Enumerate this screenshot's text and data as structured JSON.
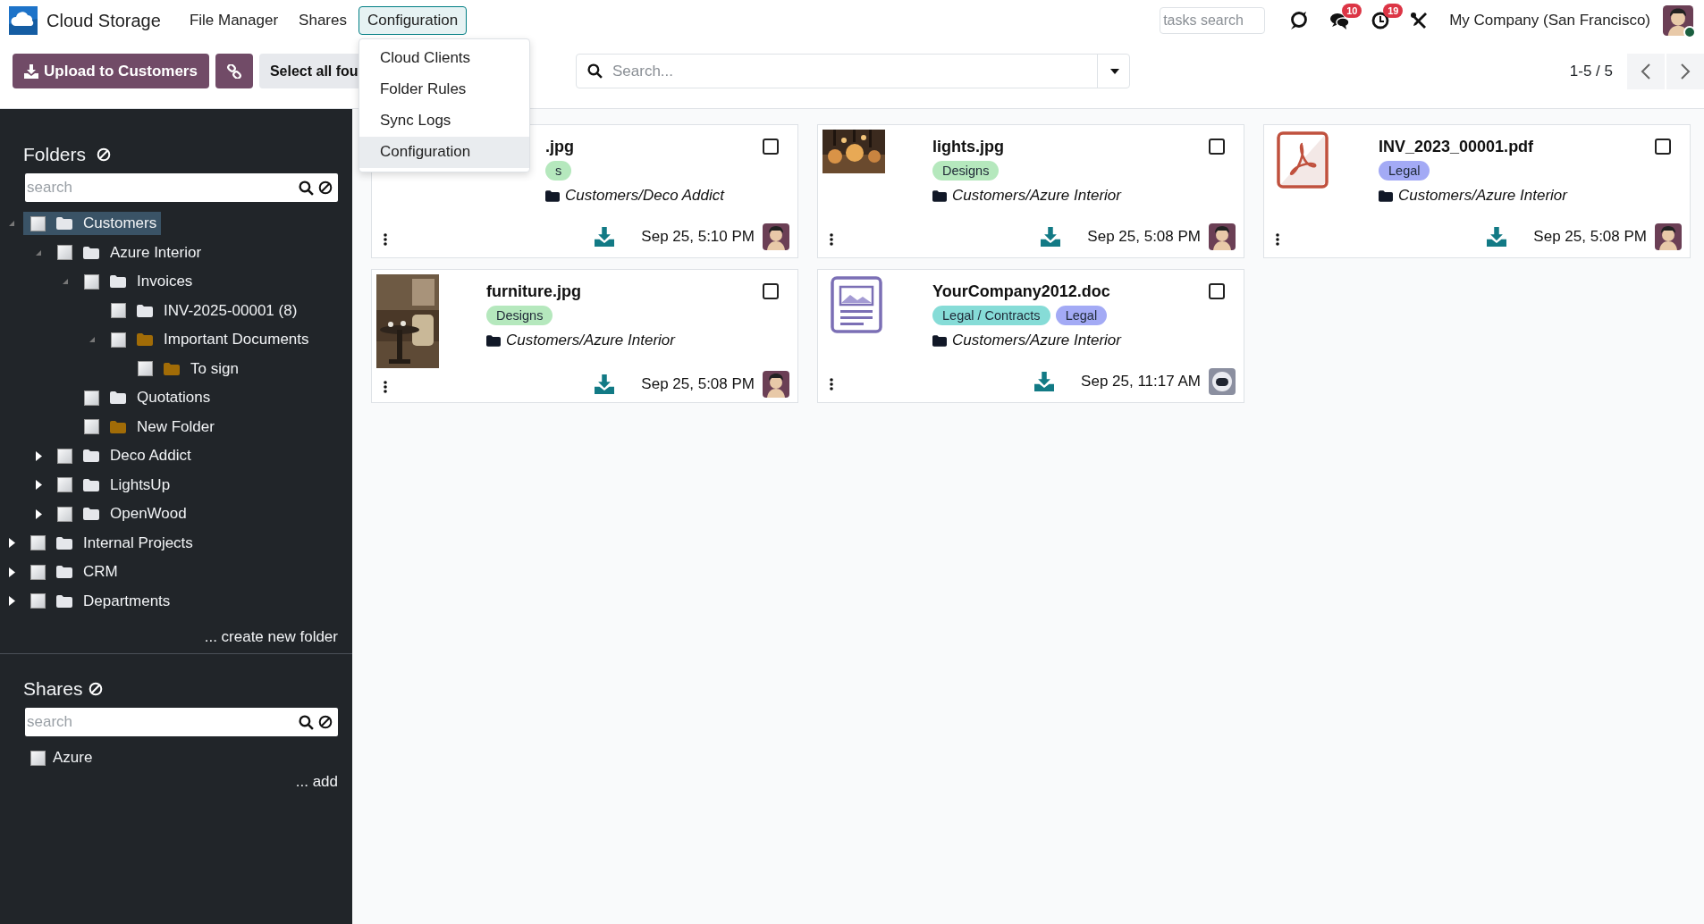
{
  "app": {
    "name": "Cloud Storage"
  },
  "menu": [
    {
      "label": "File Manager",
      "selected": false
    },
    {
      "label": "Shares",
      "selected": false
    },
    {
      "label": "Configuration",
      "selected": true
    }
  ],
  "dropdown": [
    {
      "label": "Cloud Clients",
      "selected": false
    },
    {
      "label": "Folder Rules",
      "selected": false
    },
    {
      "label": "Sync Logs",
      "selected": false
    },
    {
      "label": "Configuration",
      "selected": true
    }
  ],
  "systray": {
    "search_placeholder": "tasks search",
    "messages_badge": "10",
    "activities_badge": "19",
    "company": "My Company (San Francisco)",
    "online": true
  },
  "toolbar": {
    "upload_button": "Upload to Customers",
    "select_all_button": "Select all fou"
  },
  "search": {
    "placeholder": "Search..."
  },
  "pager": {
    "range": "1-5 / 5"
  },
  "folders": {
    "title": "Folders",
    "search_placeholder": "search",
    "create_link": "... create new folder",
    "tree": [
      {
        "label": "Customers",
        "checked": false,
        "selected": true,
        "expanded": true,
        "color": "#e5e7eb",
        "children": [
          {
            "label": "Azure Interior",
            "checked": false,
            "selected": false,
            "expanded": true,
            "color": "#e5e7eb",
            "children": [
              {
                "label": "Invoices",
                "checked": false,
                "selected": false,
                "expanded": true,
                "color": "#e5e7eb",
                "children": [
                  {
                    "label": "INV-2025-00001 (8)",
                    "checked": false,
                    "selected": false,
                    "color": "#e5e7eb"
                  },
                  {
                    "label": "Important Documents",
                    "checked": false,
                    "selected": false,
                    "expanded": true,
                    "color": "#a16c07",
                    "children": [
                      {
                        "label": "To sign",
                        "checked": false,
                        "selected": false,
                        "color": "#a16c07"
                      }
                    ]
                  }
                ]
              },
              {
                "label": "Quotations",
                "checked": false,
                "selected": false,
                "color": "#e5e7eb"
              },
              {
                "label": "New Folder",
                "checked": false,
                "selected": false,
                "color": "#a16c07"
              }
            ]
          },
          {
            "label": "Deco Addict",
            "checked": false,
            "selected": false,
            "expanded": false,
            "color": "#e5e7eb"
          },
          {
            "label": "LightsUp",
            "checked": false,
            "selected": false,
            "expanded": false,
            "color": "#e5e7eb"
          },
          {
            "label": "OpenWood",
            "checked": false,
            "selected": false,
            "expanded": false,
            "color": "#e5e7eb"
          }
        ]
      },
      {
        "label": "Internal Projects",
        "checked": false,
        "selected": false,
        "expanded": false,
        "color": "#e5e7eb"
      },
      {
        "label": "CRM",
        "checked": false,
        "selected": false,
        "expanded": false,
        "color": "#e5e7eb"
      },
      {
        "label": "Departments",
        "checked": false,
        "selected": false,
        "expanded": false,
        "color": "#e5e7eb"
      }
    ]
  },
  "shares": {
    "title": "Shares",
    "search_placeholder": "search",
    "items": [
      {
        "label": "Azure",
        "checked": false
      }
    ],
    "add_link": "... add"
  },
  "cards": [
    {
      "name": ".jpg",
      "covered": true,
      "checked": false,
      "tags": [
        {
          "label": "s",
          "color": "#b5e8bd"
        }
      ],
      "folder": "Customers/Deco Addict",
      "date": "Sep 25, 5:10 PM",
      "avatar": {
        "kind": "user"
      }
    },
    {
      "name": "lights.jpg",
      "covered": false,
      "kind": "picture",
      "checked": false,
      "tags": [
        {
          "label": "Designs",
          "color": "#b5e8bd"
        }
      ],
      "folder": "Customers/Azure Interior",
      "date": "Sep 25, 5:08 PM",
      "avatar": {
        "kind": "user"
      }
    },
    {
      "name": "INV_2023_00001.pdf",
      "covered": false,
      "kind": "pdf",
      "checked": false,
      "tags": [
        {
          "label": "Legal",
          "color": "#a3aaf5"
        }
      ],
      "folder": "Customers/Azure Interior",
      "date": "Sep 25, 5:08 PM",
      "avatar": {
        "kind": "user"
      }
    },
    {
      "name": "furniture.jpg",
      "covered": false,
      "kind": "picture",
      "checked": false,
      "tags": [
        {
          "label": "Designs",
          "color": "#b5e8bd"
        }
      ],
      "folder": "Customers/Azure Interior",
      "date": "Sep 25, 5:08 PM",
      "avatar": {
        "kind": "user"
      }
    },
    {
      "name": "YourCompany2012.doc",
      "covered": false,
      "kind": "doc",
      "checked": false,
      "tags": [
        {
          "label": "Legal / Contracts",
          "color": "#86dcd7"
        },
        {
          "label": "Legal",
          "color": "#a3aaf5"
        }
      ],
      "folder": "Customers/Azure Interior",
      "date": "Sep 25, 11:17 AM",
      "avatar": {
        "kind": "bot"
      }
    }
  ]
}
